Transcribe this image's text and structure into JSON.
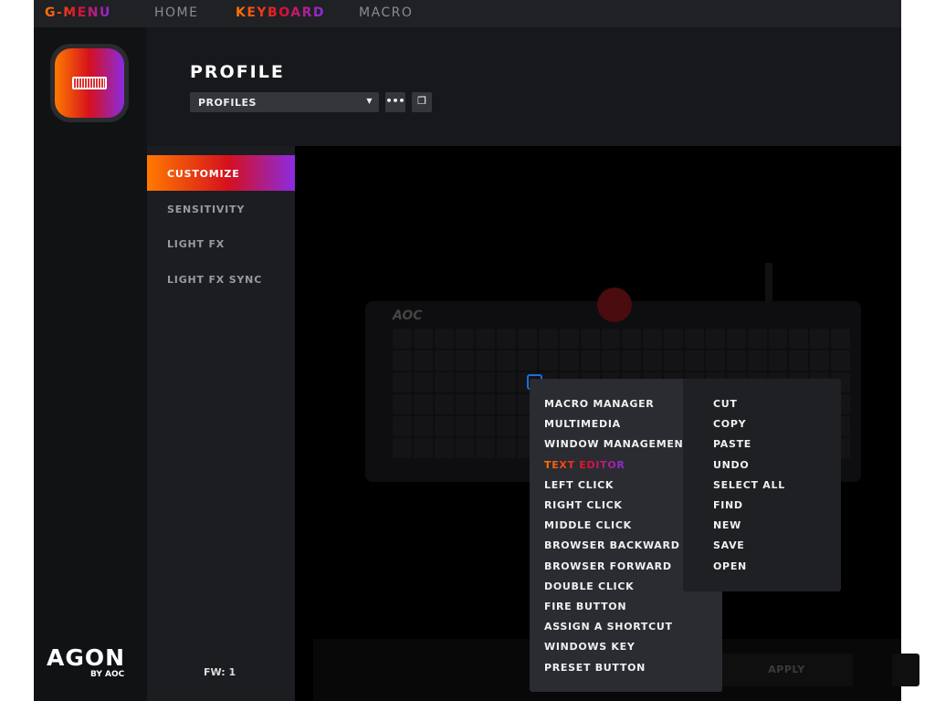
{
  "topbar": {
    "brand": "G-MENU",
    "tabs": [
      "HOME",
      "KEYBOARD",
      "MACRO"
    ],
    "active_tab": "KEYBOARD"
  },
  "sidebar": {
    "logo_text": "AGON",
    "logo_sub": "BY AOC"
  },
  "header": {
    "title": "PROFILE",
    "profile_select": "PROFILES",
    "more_label": "•••"
  },
  "submenu": {
    "items": [
      "CUSTOMIZE",
      "SENSITIVITY",
      "LIGHT FX",
      "LIGHT FX SYNC"
    ],
    "active": "CUSTOMIZE",
    "firmware": "FW: 1"
  },
  "keyboard": {
    "brand": "AOC"
  },
  "bottom": {
    "apply_label": "APPLY"
  },
  "context_menu": {
    "items": [
      "MACRO MANAGER",
      "MULTIMEDIA",
      "WINDOW MANAGEMENT",
      "TEXT EDITOR",
      "LEFT CLICK",
      "RIGHT CLICK",
      "MIDDLE CLICK",
      "BROWSER BACKWARD",
      "BROWSER FORWARD",
      "DOUBLE CLICK",
      "FIRE BUTTON",
      "ASSIGN A SHORTCUT",
      "WINDOWS KEY",
      "PRESET BUTTON"
    ],
    "highlighted": "TEXT EDITOR"
  },
  "text_editor_menu": {
    "items": [
      "CUT",
      "COPY",
      "PASTE",
      "UNDO",
      "SELECT ALL",
      "FIND",
      "NEW",
      "SAVE",
      "OPEN"
    ]
  },
  "colors": {
    "gradient_start": "#ff7a00",
    "gradient_mid": "#d5101e",
    "gradient_end": "#8a2be2",
    "selected_key": "#1a6fe0"
  }
}
